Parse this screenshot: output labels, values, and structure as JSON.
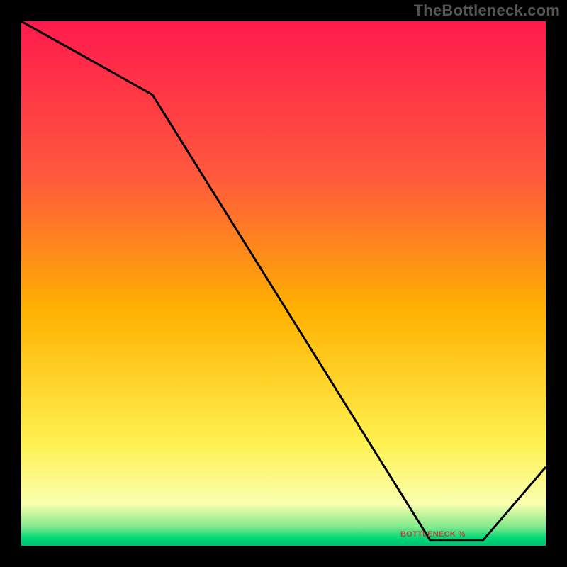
{
  "watermark": "TheBottleneck.com",
  "line_label": "BOTTLENECK %",
  "chart_data": {
    "type": "line",
    "title": "",
    "xlabel": "",
    "ylabel": "",
    "xlim": [
      0,
      100
    ],
    "ylim": [
      0,
      100
    ],
    "grid": false,
    "legend": false,
    "x": [
      0,
      25,
      78,
      88,
      100
    ],
    "values": [
      100,
      86,
      1,
      1,
      15
    ],
    "background_gradient_stops": [
      {
        "offset": 0.0,
        "color": "#ff1a4d"
      },
      {
        "offset": 0.3,
        "color": "#ff5a3c"
      },
      {
        "offset": 0.55,
        "color": "#ffb100"
      },
      {
        "offset": 0.8,
        "color": "#fff04d"
      },
      {
        "offset": 0.92,
        "color": "#faffb0"
      },
      {
        "offset": 0.965,
        "color": "#7de88a"
      },
      {
        "offset": 0.985,
        "color": "#00d977"
      },
      {
        "offset": 1.0,
        "color": "#00c070"
      }
    ],
    "line_color": "#000000",
    "line_width": 3
  }
}
